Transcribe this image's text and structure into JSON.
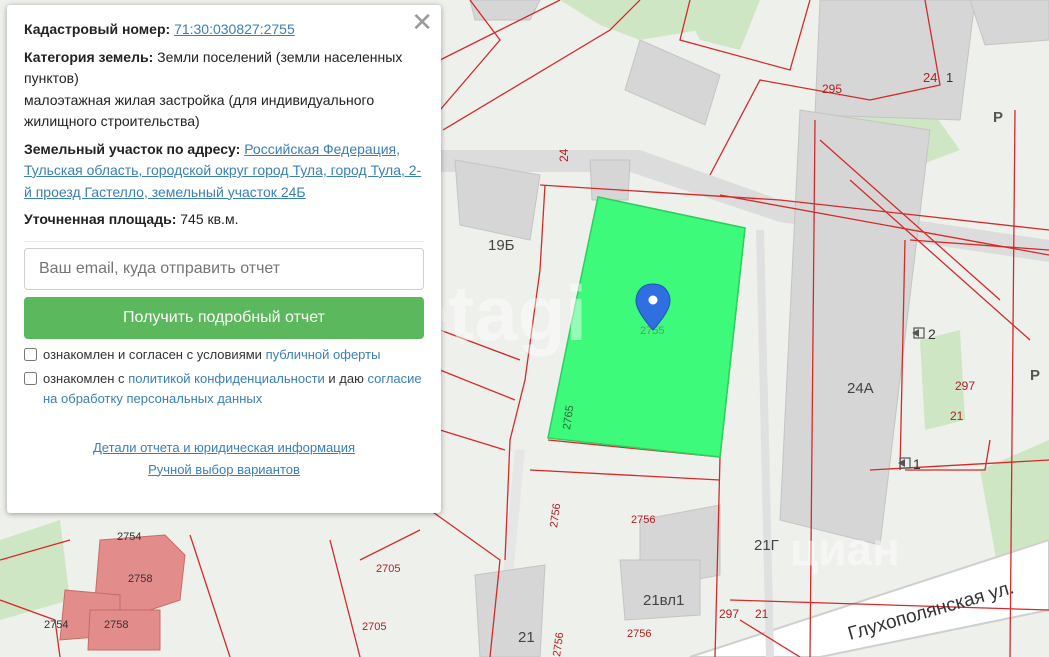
{
  "popup": {
    "close_glyph": "✕",
    "cadastral_label": "Кадастровый номер:",
    "cadastral_value": "71:30:030827:2755",
    "category_label": "Категория земель:",
    "category_value": "Земли поселений (земли населенных пунктов)",
    "usage_value": "малоэтажная жилая застройка (для индивидуального жилищного строительства)",
    "address_label": "Земельный участок по адресу:",
    "address_value": "Российская Федерация, Тульская область, городской округ город Тула, город Тула, 2-й проезд Гастелло, земельный участок 24Б",
    "area_label": "Уточненная площадь:",
    "area_value": "745 кв.м.",
    "email_placeholder": "Ваш email, куда отправить отчет",
    "submit_label": "Получить подробный отчет",
    "check1_text": "ознакомлен и согласен с условиями",
    "check1_link": "публичной оферты",
    "check2_text": "ознакомлен с",
    "check2_link": "политикой конфиденциальности",
    "check2_mid": "и даю",
    "check2_link2": "согласие на обработку персональных данных",
    "footer_link1": "Детали отчета и юридическая информация",
    "footer_link2": "Ручной выбор вариантов"
  },
  "map": {
    "watermark": "etagi",
    "watermark2": "циан",
    "street": "Глухополянская ул.",
    "parcel_highlight_color": "#3dfa7a",
    "labels": {
      "b295": "295",
      "b24_1": "24",
      "b1_top": "1",
      "pR1": "Р",
      "b24": "24",
      "b19b": "19Б",
      "pin_num": "2755",
      "p2765": "2765",
      "e2": "2",
      "b24a": "24А",
      "p297a": "297",
      "p21a": "21",
      "pR2": "Р",
      "e1": "1",
      "p2756a": "2756",
      "p2756b": "2756",
      "b21g": "21Г",
      "p2754a": "2754",
      "p2758a": "2758",
      "p2705a": "2705",
      "b21vl1": "21вл1",
      "p297b": "297",
      "p21b": "21",
      "p2754b": "2754",
      "p2758b": "2758",
      "p2705b": "2705",
      "b21": "21",
      "p2756c": "2756",
      "p2756d": "2756"
    }
  },
  "colors": {
    "map_bg": "#eef0ec",
    "building": "#d9d9d9",
    "cadastre_line": "#d42a2a",
    "pin": "#2f6fe0",
    "button": "#5cb85c",
    "link": "#3a7fb5"
  }
}
